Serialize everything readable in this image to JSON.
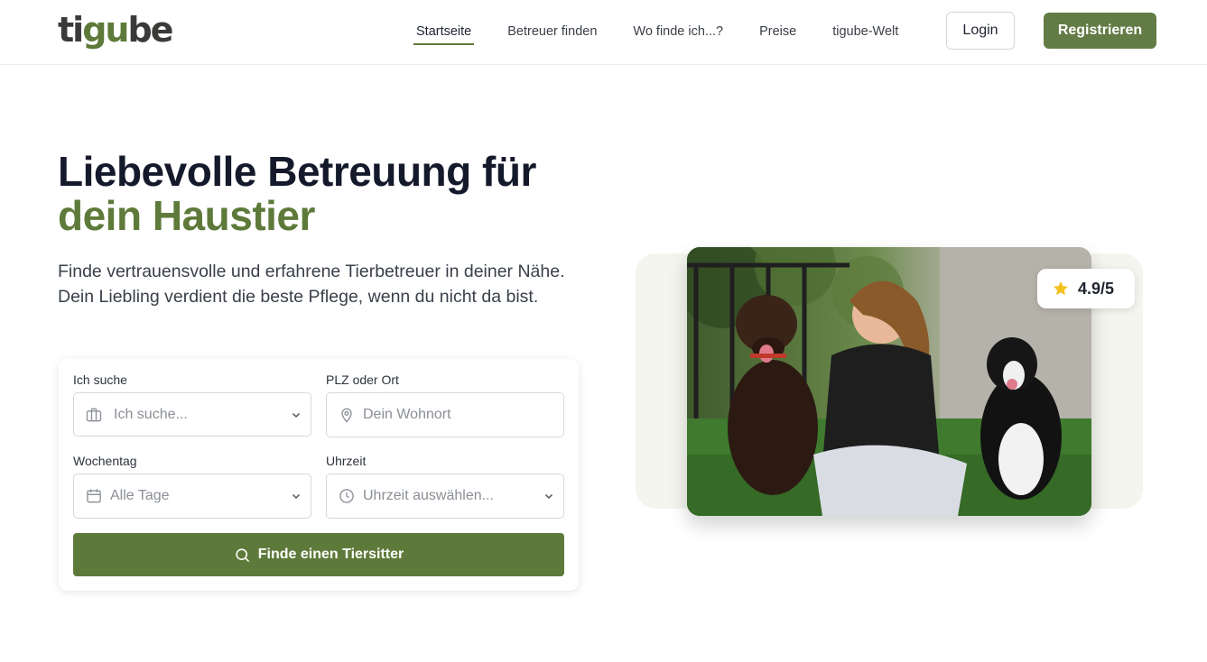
{
  "header": {
    "logo_prefix": "ti",
    "logo_accent": "gu",
    "logo_suffix": "be",
    "nav": [
      {
        "label": "Startseite",
        "active": true
      },
      {
        "label": "Betreuer finden",
        "active": false
      },
      {
        "label": "Wo finde ich...?",
        "active": false
      },
      {
        "label": "Preise",
        "active": false
      },
      {
        "label": "tigube-Welt",
        "active": false
      }
    ],
    "login_label": "Login",
    "register_label": "Registrieren"
  },
  "hero": {
    "title_line1": "Liebevolle Betreuung für",
    "title_line2": "dein Haustier",
    "subtitle": "Finde vertrauensvolle und erfahrene Tierbetreuer in deiner Nähe. Dein Liebling verdient die beste Pflege, wenn du nicht da bist."
  },
  "search": {
    "service_label": "Ich suche",
    "service_placeholder": "Ich suche...",
    "location_label": "PLZ oder Ort",
    "location_placeholder": "Dein Wohnort",
    "weekday_label": "Wochentag",
    "weekday_value": "Alle Tage",
    "time_label": "Uhrzeit",
    "time_placeholder": "Uhrzeit auswählen...",
    "submit_label": "Finde einen Tiersitter"
  },
  "rating": {
    "score": "4.9/5"
  },
  "colors": {
    "brand": "#5e7a3a",
    "title": "#141a2b",
    "star": "#f4c01e"
  },
  "icons": [
    "briefcase-icon",
    "map-pin-icon",
    "calendar-icon",
    "clock-icon",
    "chevron-down-icon",
    "search-icon",
    "star-icon"
  ]
}
